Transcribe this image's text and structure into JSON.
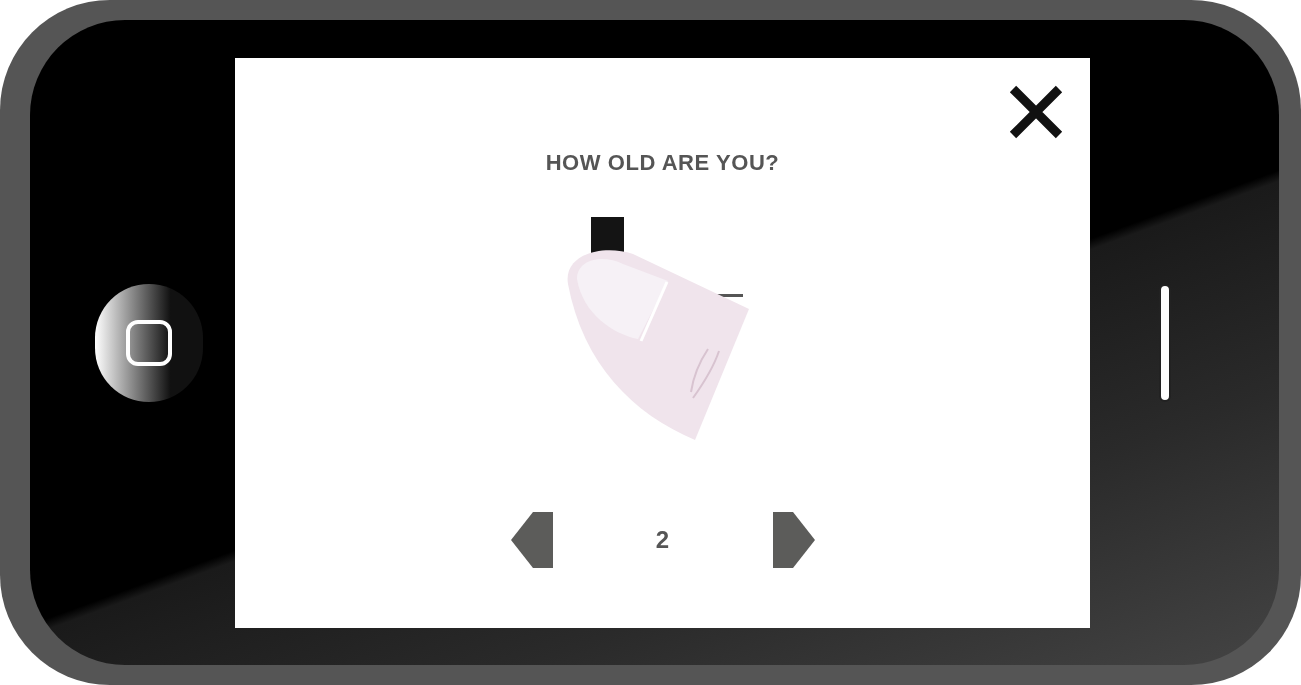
{
  "screen": {
    "title": "HOW OLD ARE YOU?",
    "page": "2"
  }
}
